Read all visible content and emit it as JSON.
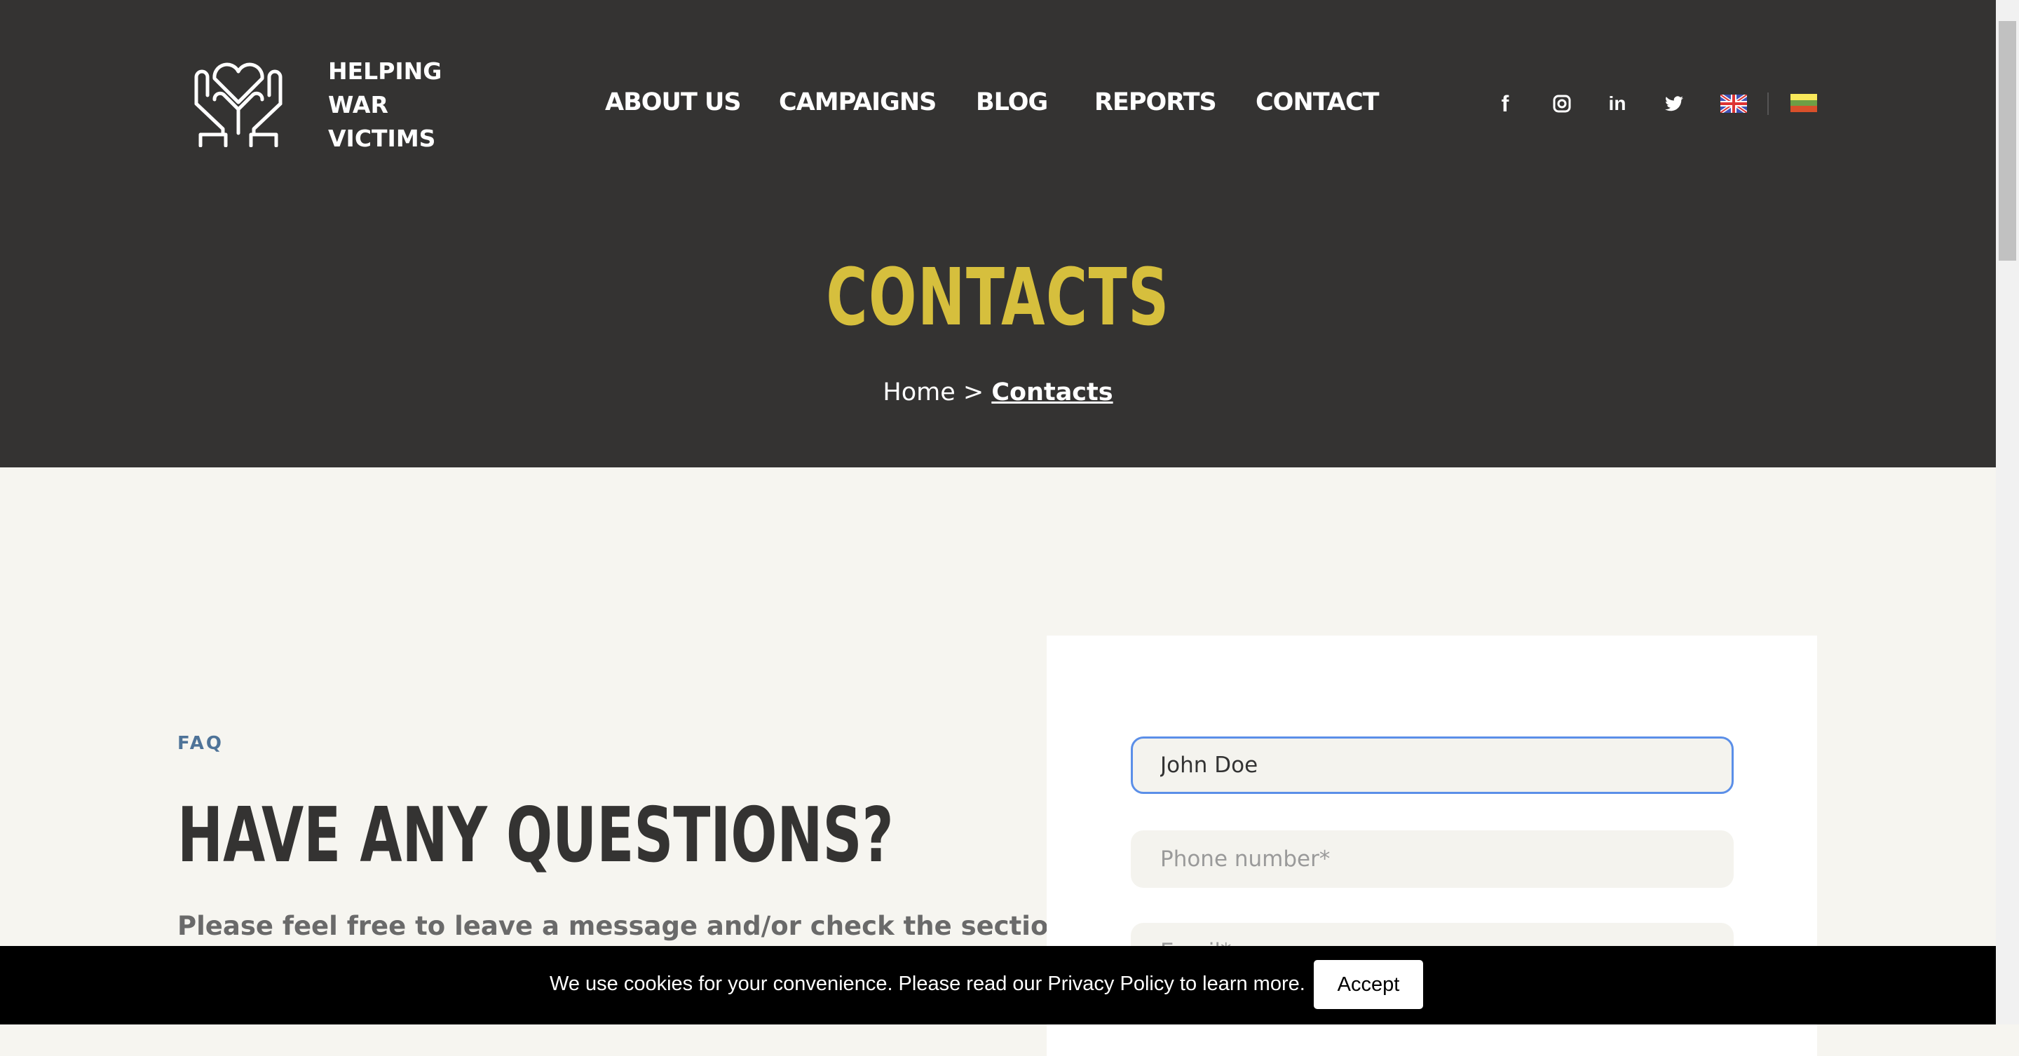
{
  "logo": {
    "lines": [
      "HELPING",
      "WAR",
      "VICTIMS"
    ]
  },
  "nav": [
    "ABOUT US",
    "CAMPAIGNS",
    "BLOG",
    "REPORTS",
    "CONTACT"
  ],
  "hero": {
    "title": "CONTACTS",
    "breadcrumb_home": "Home",
    "breadcrumb_sep": " > ",
    "breadcrumb_current": "Contacts"
  },
  "faq": {
    "eyebrow": "FAQ",
    "heading": "HAVE ANY QUESTIONS?",
    "text": "Please feel free to leave a message and/or check the section"
  },
  "form": {
    "name_value": "John Doe",
    "phone_placeholder": "Phone number*",
    "email_placeholder": "Email*"
  },
  "cookie": {
    "text": "We use cookies for your convenience. Please read our Privacy Policy to learn more.",
    "accept": "Accept"
  },
  "colors": {
    "header": "#343332",
    "accent": "#d6bf3d",
    "focus": "#5b8fe8"
  }
}
